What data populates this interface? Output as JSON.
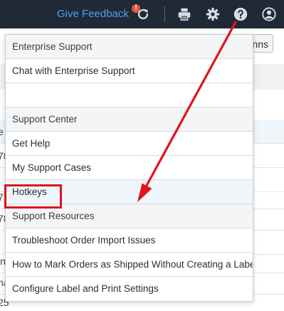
{
  "topbar": {
    "feedback_label": "Give Feedback",
    "alert_badge": "!",
    "icons": [
      "refresh-icon",
      "printer-icon",
      "gear-icon",
      "help-icon",
      "user-icon"
    ]
  },
  "background": {
    "button_fragment": "nns",
    "row_fragments": [
      "e",
      "78",
      "",
      "7",
      "",
      "78",
      "",
      "in",
      "na",
      "25"
    ]
  },
  "menu": {
    "sections": [
      {
        "header": "Enterprise Support",
        "items": [
          "Chat with Enterprise Support",
          ""
        ]
      },
      {
        "header": "Support Center",
        "items": [
          "Get Help",
          "My Support Cases",
          "Hotkeys"
        ]
      },
      {
        "header": "Support Resources",
        "items": [
          "Troubleshoot Order Import Issues",
          "How to Mark Orders as Shipped Without Creating a Label",
          "Configure Label and Print Settings"
        ]
      }
    ]
  },
  "annotation": {
    "highlighted_item": "Hotkeys",
    "colors": {
      "box": "#e0141e",
      "arrow": "#e0141e"
    }
  },
  "colors": {
    "topbar": "#1f2a36",
    "feedback_link": "#4aa3e8",
    "alert": "#e8543a",
    "menu_header_bg": "#f4f5f6",
    "hover_bg": "#eef5fb"
  }
}
